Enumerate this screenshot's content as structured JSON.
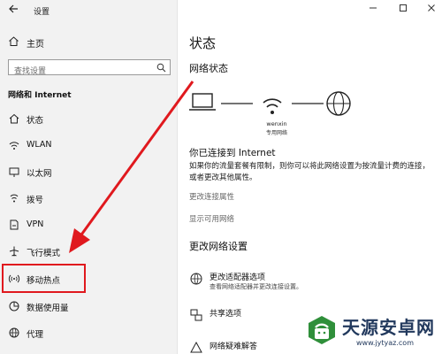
{
  "app": {
    "title": "设置"
  },
  "sidebar": {
    "home_label": "主页",
    "search_placeholder": "查找设置",
    "section_title": "网络和 Internet",
    "items": [
      {
        "label": "状态",
        "icon": "home-icon"
      },
      {
        "label": "WLAN",
        "icon": "wifi-icon"
      },
      {
        "label": "以太网",
        "icon": "ethernet-icon"
      },
      {
        "label": "拨号",
        "icon": "phone-icon"
      },
      {
        "label": "VPN",
        "icon": "vpn-icon"
      },
      {
        "label": "飞行模式",
        "icon": "airplane-icon"
      },
      {
        "label": "移动热点",
        "icon": "hotspot-icon"
      },
      {
        "label": "数据使用量",
        "icon": "data-usage-icon"
      },
      {
        "label": "代理",
        "icon": "globe-icon"
      }
    ]
  },
  "main": {
    "title": "状态",
    "network_status_title": "网络状态",
    "network_name": "wenxin",
    "network_type": "专用网络",
    "connected_title": "你已连接到 Internet",
    "connected_desc": "如果你的流量套餐有限制，则你可以将此网络设置为按流量计费的连接，或者更改其他属性。",
    "link_change_props": "更改连接属性",
    "link_show_networks": "显示可用网络",
    "change_settings_title": "更改网络设置",
    "options": [
      {
        "title": "更改适配器选项",
        "desc": "查看网络适配器并更改连接设置。",
        "icon": "adapter-icon"
      },
      {
        "title": "共享选项",
        "desc": "",
        "icon": "sharing-icon"
      },
      {
        "title": "网络疑难解答",
        "desc": "",
        "icon": "troubleshoot-icon"
      }
    ]
  },
  "colors": {
    "annotation": "#e0191e",
    "sidebar_bg": "#f2f2f2"
  },
  "watermark": {
    "name": "天源安卓网",
    "url": "www.jytyaz.com"
  }
}
